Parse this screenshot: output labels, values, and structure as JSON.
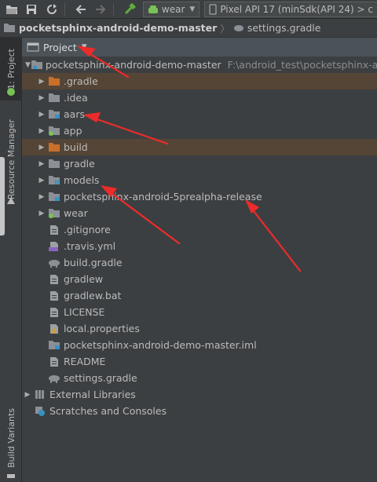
{
  "toolbar": {
    "module_combo": "wear",
    "device_combo": "Pixel API 17 (minSdk(API 24) > c"
  },
  "breadcrumb": {
    "root": "pocketsphinx-android-demo-master",
    "file": "settings.gradle"
  },
  "side_tabs": {
    "project": "1: Project",
    "resource_manager": "Resource Manager",
    "build_variants": "Build Variants"
  },
  "panel": {
    "title": "Project"
  },
  "tree": {
    "root_label": "pocketsphinx-android-demo-master",
    "root_path": "F:\\android_test\\pocketsphinx-and",
    "items": [
      {
        "label": ".gradle"
      },
      {
        "label": ".idea"
      },
      {
        "label": "aars"
      },
      {
        "label": "app"
      },
      {
        "label": "build"
      },
      {
        "label": "gradle"
      },
      {
        "label": "models"
      },
      {
        "label": "pocketsphinx-android-5prealpha-release"
      },
      {
        "label": "wear"
      },
      {
        "label": ".gitignore"
      },
      {
        "label": ".travis.yml"
      },
      {
        "label": "build.gradle"
      },
      {
        "label": "gradlew"
      },
      {
        "label": "gradlew.bat"
      },
      {
        "label": "LICENSE"
      },
      {
        "label": "local.properties"
      },
      {
        "label": "pocketsphinx-android-demo-master.iml"
      },
      {
        "label": "README"
      },
      {
        "label": "settings.gradle"
      }
    ],
    "external_libraries": "External Libraries",
    "scratches": "Scratches and Consoles"
  },
  "colors": {
    "annotation_arrow": "#ee2b2b",
    "excluded_folder": "#c8702a",
    "folder": "#8b9096",
    "android_green": "#78c257"
  }
}
